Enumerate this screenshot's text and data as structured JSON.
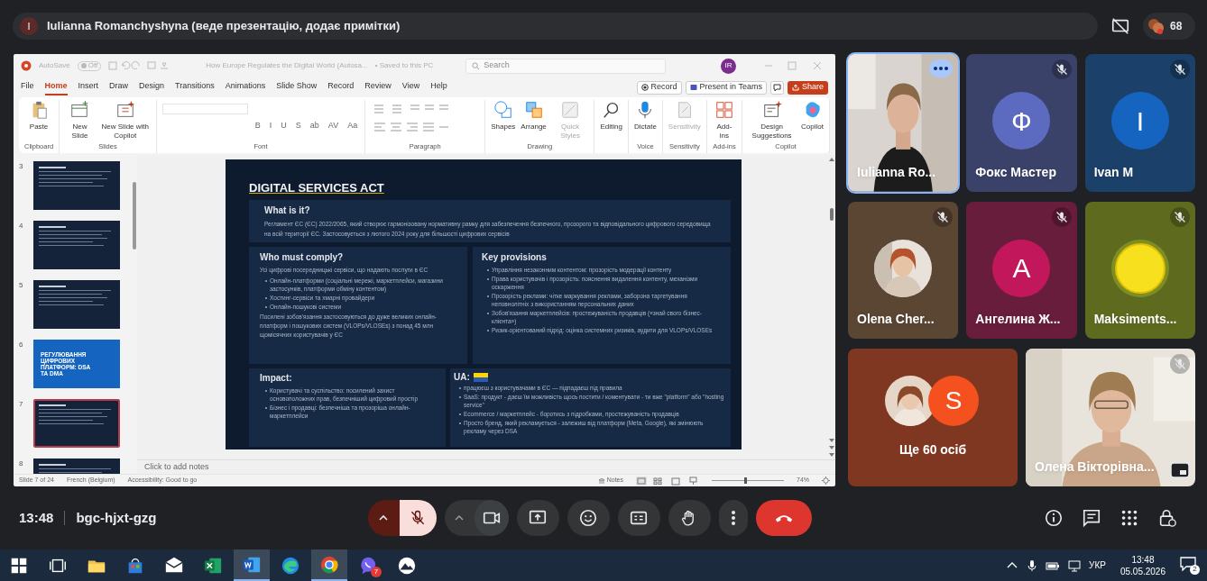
{
  "banner": {
    "initial": "I",
    "text": "Iulianna Romanchyshyna (веде презентацію, додає примітки)",
    "participant_count": "68"
  },
  "powerpoint": {
    "autosave_label": "AutoSave",
    "autosave_state": "Off",
    "document_title": "How Europe Regulates the Digital World (Autosa...",
    "save_status": "• Saved to this PC",
    "search_placeholder": "Search",
    "account_initials": "IR",
    "tabs": [
      {
        "label": "File",
        "selected": false
      },
      {
        "label": "Home",
        "selected": true
      },
      {
        "label": "Insert",
        "selected": false
      },
      {
        "label": "Draw",
        "selected": false
      },
      {
        "label": "Design",
        "selected": false
      },
      {
        "label": "Transitions",
        "selected": false
      },
      {
        "label": "Animations",
        "selected": false
      },
      {
        "label": "Slide Show",
        "selected": false
      },
      {
        "label": "Record",
        "selected": false
      },
      {
        "label": "Review",
        "selected": false
      },
      {
        "label": "View",
        "selected": false
      },
      {
        "label": "Help",
        "selected": false
      }
    ],
    "actions": [
      {
        "kind": "record",
        "label": "Record"
      },
      {
        "kind": "teams",
        "label": "Present in Teams"
      },
      {
        "kind": "share",
        "label": "Share"
      }
    ],
    "ribbon_groups": [
      {
        "label": "Clipboard",
        "buttons": [
          {
            "kind": "paste",
            "label": "Paste"
          }
        ]
      },
      {
        "label": "Slides",
        "buttons": [
          {
            "kind": "new-slide",
            "label": "New Slide"
          },
          {
            "kind": "copilot-slide",
            "label": "New Slide with Copilot"
          }
        ]
      },
      {
        "label": "Font",
        "buttons": [
          {
            "kind": "font",
            "label": "B"
          },
          {
            "kind": "font",
            "label": "I"
          },
          {
            "kind": "font",
            "label": "U"
          },
          {
            "kind": "font",
            "label": "S"
          },
          {
            "kind": "font",
            "label": "ab"
          },
          {
            "kind": "font",
            "label": "AV"
          },
          {
            "kind": "font",
            "label": "Aa"
          }
        ]
      },
      {
        "label": "Paragraph",
        "buttons": [
          {
            "kind": "paragraph"
          }
        ]
      },
      {
        "label": "Drawing",
        "buttons": [
          {
            "kind": "shapes",
            "label": "Shapes"
          },
          {
            "kind": "arrange",
            "label": "Arrange"
          },
          {
            "kind": "styles",
            "label": "Quick Styles"
          }
        ]
      },
      {
        "buttons": [
          {
            "kind": "editing",
            "label": "Editing"
          }
        ]
      },
      {
        "label": "Voice",
        "buttons": [
          {
            "kind": "dictate",
            "label": "Dictate"
          }
        ]
      },
      {
        "label": "Sensitivity",
        "buttons": [
          {
            "kind": "sensitivity",
            "label": "Sensitivity"
          }
        ]
      },
      {
        "label": "Add-ins",
        "buttons": [
          {
            "kind": "addins",
            "label": "Add-ins"
          }
        ]
      },
      {
        "label": "Copilot",
        "buttons": [
          {
            "kind": "design",
            "label": "Design Suggestions"
          },
          {
            "kind": "copilot",
            "label": "Copilot"
          }
        ]
      }
    ],
    "thumbnails": [
      {
        "number": "3",
        "kind": "dark",
        "selected": false
      },
      {
        "number": "4",
        "kind": "dark",
        "selected": false
      },
      {
        "number": "5",
        "kind": "dark",
        "selected": false
      },
      {
        "number": "6",
        "kind": "title",
        "title": "РЕГУЛЮВАННЯ ЦИФРОВИХ ПЛАТФОРМ: DSA ТА DMA",
        "selected": false
      },
      {
        "number": "7",
        "kind": "dark",
        "selected": true
      },
      {
        "number": "8",
        "kind": "dark",
        "selected": false
      }
    ],
    "slide": {
      "title": "DIGITAL SERVICES ACT",
      "what": {
        "heading": "What is it?",
        "text": "Регламент ЄС (ЄС) 2022/2065, який створює гармонізовану нормативну рамку для забезпечення безпечного, прозорого та відповідального цифрового середовища на всій території ЄС. Застосовується з лютого 2024 року для більшості цифрових сервісів"
      },
      "who": {
        "heading": "Who must comply?",
        "intro": "Усі цифрові посередницькі сервіси, що надають послуги в ЄС",
        "bullets": [
          "Онлайн-платформи (соціальні мережі, маркетплейси, магазини застосунків, платформи обміну контентом)",
          "Хостинг-сервіси та хмарні провайдери",
          "Онлайн-пошукові системи"
        ],
        "outro": "Посилені зобов'язання застосовуються до дуже великих онлайн-платформ і пошукових систем (VLOPs/VLOSEs) з понад 45 млн щомісячних користувачів у ЄС"
      },
      "key": {
        "heading": "Key provisions",
        "bullets": [
          "Управління незаконним контентом: прозорість модерації контенту",
          "Права користувачів і прозорість: пояснення видалення контенту, механізми оскарження",
          "Прозорість реклами: чітке маркування реклами, заборона таргетування неповнолітніх з використанням персональних даних",
          "Зобов'язання маркетплейсів: простежуваність продавців («знай свого бізнес-клієнта»)",
          "Ризик-орієнтований підхід: оцінка системних ризиків, аудити для VLOPs/VLOSEs"
        ]
      },
      "impact": {
        "heading": "Impact:",
        "bullets": [
          "Користувачі та суспільство: посилений захист основоположних прав, безпечніший цифровий простір",
          "Бізнес і продавці: безпечніша та прозоріша онлайн-маркетплейси"
        ]
      },
      "ua": {
        "heading": "UA:",
        "bullets": [
          "працюєш з користувачами в ЄС — підпадаєш під правила",
          "SaaS: продукт - даєш їм можливість щось постити / коментувати - ти вже \"platform\" або \"hosting service\"",
          "Ecommerce / маркетплейс - боротись з підробками, простежуваність продавців",
          "Просто бренд, який рекламується -  залежиш від платформ (Meta, Google), які змінюють рекламу через DSA"
        ]
      }
    },
    "notes_placeholder": "Click to add notes",
    "status_bar": {
      "slide_counter": "Slide 7 of 24",
      "language": "French (Belgium)",
      "accessibility": "Accessibility: Good to go",
      "notes": "Notes",
      "zoom": "74%",
      "level": 0.45
    }
  },
  "participants": [
    {
      "kind": "video",
      "name": "Iulianna Ro...",
      "muted": false,
      "highlighted": true
    },
    {
      "kind": "avatar",
      "name": "Фокс Мастер",
      "initial": "Ф",
      "color": "#5c6bc0",
      "muted": true,
      "highlighted": false
    },
    {
      "kind": "avatar",
      "name": "Ivan M",
      "initial": "I",
      "color": "#1565c0",
      "muted": true,
      "highlighted": false
    },
    {
      "name": "Olena Cher...",
      "color": "#5b4634",
      "muted": true,
      "highlighted": false
    },
    {
      "kind": "avatar",
      "name": "Ангелина Ж...",
      "initial": "A",
      "color": "#c2185b",
      "muted": true,
      "highlighted": false
    },
    {
      "name": "Maksiments...",
      "color": "#5e6b1f",
      "muted": true,
      "highlighted": false
    },
    {
      "kind": "others",
      "name": "Ще 60 осіб",
      "initial": "S",
      "color": "#f4511e",
      "muted": false,
      "highlighted": false
    },
    {
      "kind": "video",
      "name": "Олена Вікторівна...",
      "muted": true,
      "highlighted": false
    }
  ],
  "call": {
    "time": "13:48",
    "code": "bgc-hjxt-gzg",
    "mic_on": false,
    "camera_on": true
  },
  "taskbar": {
    "messenger_badge": "7",
    "language": "УКР",
    "time": "13:48",
    "date": "05.05.2026",
    "notifications": "2"
  }
}
